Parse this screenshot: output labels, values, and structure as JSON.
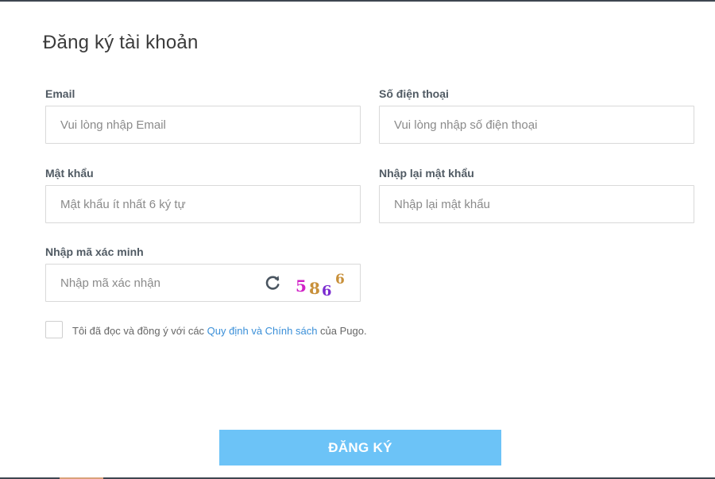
{
  "form": {
    "title": "Đăng ký tài khoản",
    "email": {
      "label": "Email",
      "placeholder": "Vui lòng nhập Email",
      "value": ""
    },
    "phone": {
      "label": "Số điện thoại",
      "placeholder": "Vui lòng nhập số điện thoại",
      "value": ""
    },
    "password": {
      "label": "Mật khẩu",
      "placeholder": "Mật khẩu ít nhất 6 ký tự",
      "value": ""
    },
    "confirm_password": {
      "label": "Nhập lại mật khẩu",
      "placeholder": "Nhập lại mật khẩu",
      "value": ""
    },
    "captcha": {
      "label": "Nhập mã xác minh",
      "placeholder": "Nhập mã xác nhận",
      "value": "",
      "refresh_icon": "refresh-icon",
      "code": [
        "5",
        "8",
        "6",
        "6"
      ],
      "code_colors": [
        "#d021c6",
        "#c8903a",
        "#7a2bd0",
        "#c8903a"
      ]
    },
    "agreement": {
      "checked": false,
      "prefix": "Tôi đã đọc và đồng ý với các ",
      "link_text": "Quy định và Chính sách",
      "suffix": " của Pugo."
    },
    "submit_label": "ĐĂNG KÝ"
  },
  "colors": {
    "accent": "#6cc3f7",
    "link": "#3a8fd8",
    "label": "#505a63",
    "border": "#d9d9d9"
  }
}
